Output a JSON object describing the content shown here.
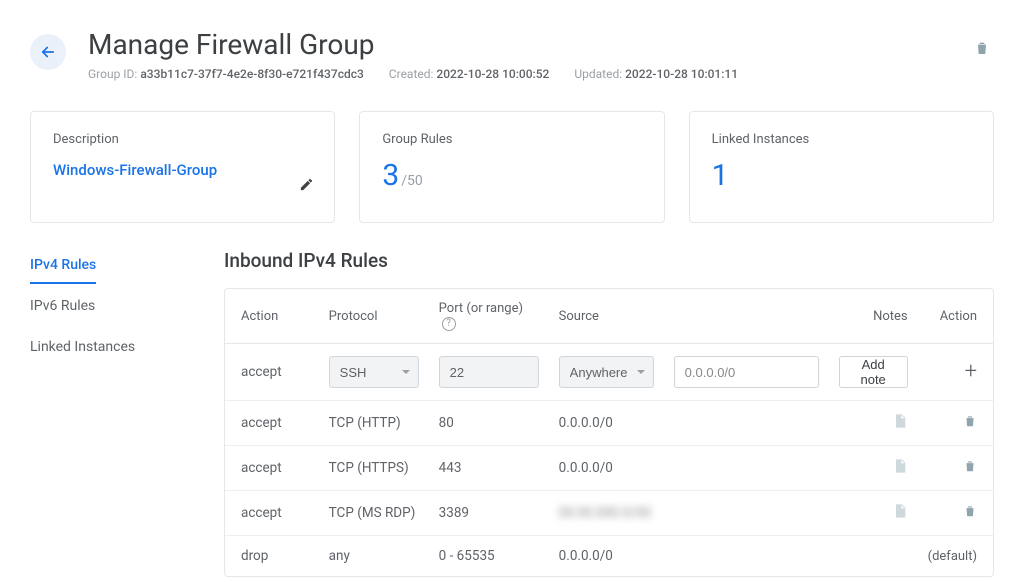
{
  "header": {
    "title": "Manage Firewall Group",
    "group_id_label": "Group ID:",
    "group_id": "a33b11c7-37f7-4e2e-8f30-e721f437cdc3",
    "created_label": "Created:",
    "created": "2022-10-28 10:00:52",
    "updated_label": "Updated:",
    "updated": "2022-10-28 10:01:11"
  },
  "cards": {
    "description_label": "Description",
    "description_value": "Windows-Firewall-Group",
    "rules_label": "Group Rules",
    "rules_count": "3",
    "rules_max": "/50",
    "linked_label": "Linked Instances",
    "linked_count": "1"
  },
  "tabs": {
    "ipv4": "IPv4 Rules",
    "ipv6": "IPv6 Rules",
    "linked": "Linked Instances"
  },
  "section_title": "Inbound IPv4 Rules",
  "columns": {
    "action": "Action",
    "protocol": "Protocol",
    "port": "Port (or range)",
    "source": "Source",
    "notes": "Notes",
    "action2": "Action"
  },
  "new_rule": {
    "action": "accept",
    "protocol": "SSH",
    "port": "22",
    "source_type": "Anywhere",
    "source_ip": "0.0.0.0/0",
    "add_note_label": "Add note"
  },
  "rules": [
    {
      "action": "accept",
      "protocol": "TCP (HTTP)",
      "port": "80",
      "source": "0.0.0.0/0",
      "blurred": false
    },
    {
      "action": "accept",
      "protocol": "TCP (HTTPS)",
      "port": "443",
      "source": "0.0.0.0/0",
      "blurred": false
    },
    {
      "action": "accept",
      "protocol": "TCP (MS RDP)",
      "port": "3389",
      "source": "00.00.000.0/00",
      "blurred": true
    }
  ],
  "default_rule": {
    "action": "drop",
    "protocol": "any",
    "port": "0 - 65535",
    "source": "0.0.0.0/0",
    "label": "(default)"
  }
}
